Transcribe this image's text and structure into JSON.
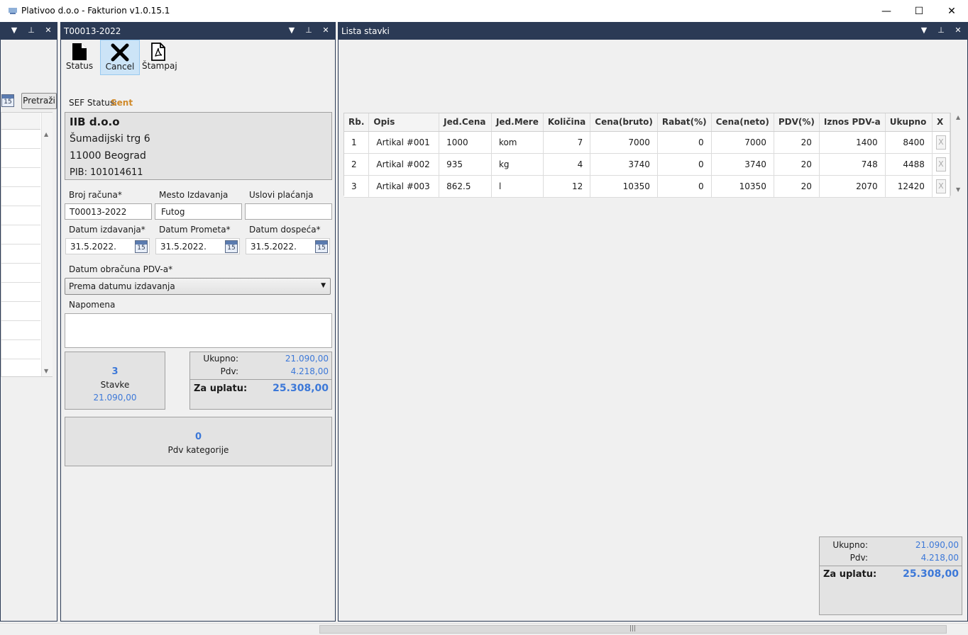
{
  "window": {
    "title": "Plativoo d.o.o - Fakturion v1.0.15.1",
    "minimize": "—",
    "maximize": "☐",
    "close": "✕"
  },
  "left_panel": {
    "search_button": "Pretraži",
    "cal_day": "15"
  },
  "invoice_panel": {
    "title": "T00013-2022",
    "toolbar": {
      "status_label": "Status",
      "cancel_label": "Cancel",
      "print_label": "Štampaj"
    },
    "sef_status_label": "SEF Status:",
    "sef_status_value": "Sent",
    "customer": {
      "name": "IIB d.o.o",
      "street": "Šumadijski trg 6",
      "city": "11000 Beograd",
      "pib_label": "PIB:",
      "pib": "101014611"
    },
    "fields": {
      "broj_racuna_label": "Broj računa*",
      "broj_racuna_value": "T00013-2022",
      "mesto_label": "Mesto Izdavanja",
      "mesto_value": "Futog",
      "uslovi_label": "Uslovi plaćanja",
      "uslovi_value": "",
      "datum_izdavanja_label": "Datum izdavanja*",
      "datum_izdavanja_value": "31.5.2022.",
      "datum_prometa_label": "Datum Prometa*",
      "datum_prometa_value": "31.5.2022.",
      "datum_dospeca_label": "Datum dospeća*",
      "datum_dospeca_value": "31.5.2022.",
      "cal_day": "15",
      "pdv_obracun_label": "Datum obračuna PDV-a*",
      "pdv_obracun_value": "Prema datumu izdavanja",
      "napomena_label": "Napomena",
      "napomena_value": ""
    },
    "stavke_summary": {
      "count": "3",
      "label": "Stavke",
      "amount": "21.090,00"
    },
    "totals": {
      "ukupno_label": "Ukupno:",
      "ukupno_value": "21.090,00",
      "pdv_label": "Pdv:",
      "pdv_value": "4.218,00",
      "za_uplatu_label": "Za uplatu:",
      "za_uplatu_value": "25.308,00"
    },
    "pdv_kategorije": {
      "count": "0",
      "label": "Pdv kategorije"
    }
  },
  "items_panel": {
    "title": "Lista stavki",
    "columns": [
      "Rb.",
      "Opis",
      "Jed.Cena",
      "Jed.Mere",
      "Količina",
      "Cena(bruto)",
      "Rabat(%)",
      "Cena(neto)",
      "PDV(%)",
      "Iznos PDV-a",
      "Ukupno",
      "X"
    ],
    "rows": [
      [
        "1",
        "Artikal #001",
        "1000",
        "kom",
        "7",
        "7000",
        "0",
        "7000",
        "20",
        "1400",
        "8400"
      ],
      [
        "2",
        "Artikal #002",
        "935",
        "kg",
        "4",
        "3740",
        "0",
        "3740",
        "20",
        "748",
        "4488"
      ],
      [
        "3",
        "Artikal #003",
        "862.5",
        "l",
        "12",
        "10350",
        "0",
        "10350",
        "20",
        "2070",
        "12420"
      ]
    ],
    "remove_label": "X",
    "totals": {
      "ukupno_label": "Ukupno:",
      "ukupno_value": "21.090,00",
      "pdv_label": "Pdv:",
      "pdv_value": "4.218,00",
      "za_uplatu_label": "Za uplatu:",
      "za_uplatu_value": "25.308,00"
    }
  },
  "colors": {
    "header_bg": "#2b3a55",
    "accent_blue": "#3c78d8",
    "sent_orange": "#d08a2a"
  }
}
